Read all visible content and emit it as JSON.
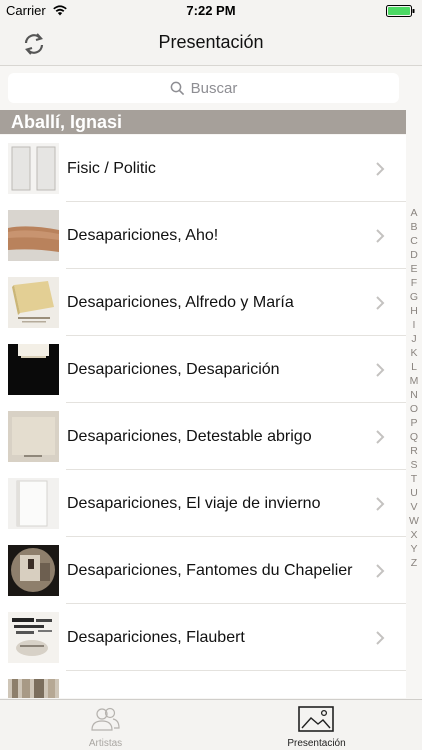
{
  "status_bar": {
    "carrier": "Carrier",
    "time": "7:22 PM",
    "battery_color": "#4cd964"
  },
  "nav": {
    "title": "Presentación",
    "left_icon": "refresh-icon"
  },
  "search": {
    "placeholder": "Buscar"
  },
  "section": {
    "header": "Aballí, Ignasi",
    "color": "#a6a09a"
  },
  "items": [
    {
      "label": "Fisic / Politic",
      "thumb": "thumb-fisic"
    },
    {
      "label": "Desapariciones, Aho!",
      "thumb": "thumb-aho"
    },
    {
      "label": "Desapariciones, Alfredo y María",
      "thumb": "thumb-alfredo"
    },
    {
      "label": "Desapariciones, Desaparición",
      "thumb": "thumb-desaparicion"
    },
    {
      "label": "Desapariciones, Detestable abrigo",
      "thumb": "thumb-abrigo"
    },
    {
      "label": "Desapariciones, El viaje de invierno",
      "thumb": "thumb-viaje"
    },
    {
      "label": "Desapariciones, Fantomes du Chapelier",
      "thumb": "thumb-fantomes"
    },
    {
      "label": "Desapariciones, Flaubert",
      "thumb": "thumb-flaubert"
    },
    {
      "label": "",
      "thumb": "thumb-partial"
    }
  ],
  "index": [
    "A",
    "B",
    "C",
    "D",
    "E",
    "F",
    "G",
    "H",
    "I",
    "J",
    "K",
    "L",
    "M",
    "N",
    "O",
    "P",
    "Q",
    "R",
    "S",
    "T",
    "U",
    "V",
    "W",
    "X",
    "Y",
    "Z"
  ],
  "tabs": [
    {
      "label": "Artistas",
      "icon": "people-icon",
      "selected": false
    },
    {
      "label": "Presentación",
      "icon": "image-icon",
      "selected": true
    }
  ]
}
